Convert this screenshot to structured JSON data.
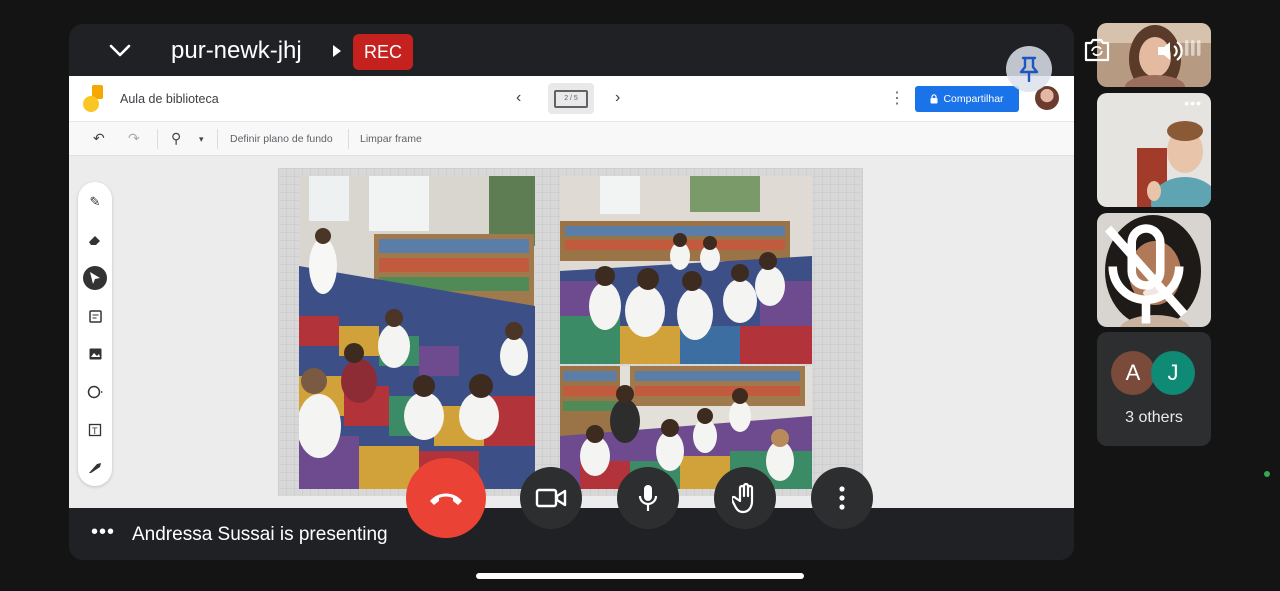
{
  "meeting": {
    "code": "pur-newk-jhj",
    "rec_label": "REC",
    "presenter_text": "Andressa Sussai is presenting"
  },
  "jamboard": {
    "title": "Aula de biblioteca",
    "frame_indicator": "2 / 5",
    "share_label": "Compartilhar",
    "toolbar": {
      "set_background": "Definir plano de fundo",
      "clear_frame": "Limpar frame"
    },
    "tools": [
      "pen-icon",
      "eraser-icon",
      "select-icon",
      "sticky-note-icon",
      "image-icon",
      "circle-icon",
      "text-box-icon",
      "laser-icon"
    ]
  },
  "participants": {
    "others": {
      "avatars": [
        {
          "letter": "A",
          "color": "#7a4a3a"
        },
        {
          "letter": "J",
          "color": "#0f8a74"
        }
      ],
      "label": "3 others"
    }
  },
  "colors": {
    "end_call": "#ea4335",
    "rec": "#c5221f",
    "share": "#1a73e8",
    "background": "#141414",
    "card": "#202124"
  }
}
